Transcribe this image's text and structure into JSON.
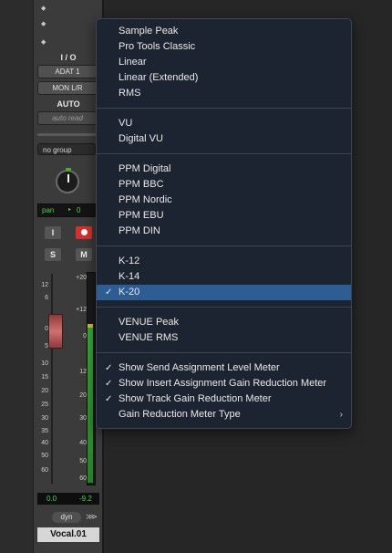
{
  "strip": {
    "io_label": "I / O",
    "input": "ADAT 1",
    "output": "MON L/R",
    "auto_label": "AUTO",
    "auto_mode": "auto read",
    "group": "no group",
    "pan_label": "pan",
    "pan_value": "0",
    "input_button": "I",
    "solo_button": "S",
    "mute_button": "M",
    "fader_scale": [
      "12",
      "6",
      "0",
      "5",
      "10",
      "15",
      "20",
      "25",
      "30",
      "35",
      "40",
      "50",
      "60"
    ],
    "meter_scale": [
      "+20",
      "+12",
      "0",
      "12",
      "20",
      "30",
      "40",
      "50",
      "60"
    ],
    "volume": "0.0",
    "peak": "-9.2",
    "dyn_label": "dyn",
    "track_name": "Vocal.01"
  },
  "menu": {
    "groups": [
      [
        {
          "label": "Sample Peak",
          "checked": false
        },
        {
          "label": "Pro Tools Classic",
          "checked": false
        },
        {
          "label": "Linear",
          "checked": false
        },
        {
          "label": "Linear (Extended)",
          "checked": false
        },
        {
          "label": "RMS",
          "checked": false
        }
      ],
      [
        {
          "label": "VU",
          "checked": false
        },
        {
          "label": "Digital VU",
          "checked": false
        }
      ],
      [
        {
          "label": "PPM Digital",
          "checked": false
        },
        {
          "label": "PPM BBC",
          "checked": false
        },
        {
          "label": "PPM Nordic",
          "checked": false
        },
        {
          "label": "PPM EBU",
          "checked": false
        },
        {
          "label": "PPM DIN",
          "checked": false
        }
      ],
      [
        {
          "label": "K-12",
          "checked": false
        },
        {
          "label": "K-14",
          "checked": false
        },
        {
          "label": "K-20",
          "checked": true,
          "highlighted": true
        }
      ],
      [
        {
          "label": "VENUE Peak",
          "checked": false
        },
        {
          "label": "VENUE RMS",
          "checked": false
        }
      ],
      [
        {
          "label": "Show Send Assignment Level Meter",
          "checked": true
        },
        {
          "label": "Show Insert Assignment Gain Reduction Meter",
          "checked": true
        },
        {
          "label": "Show Track Gain Reduction Meter",
          "checked": true
        },
        {
          "label": "Gain Reduction Meter Type",
          "checked": false,
          "submenu": true
        }
      ]
    ],
    "check_glyph": "✓",
    "submenu_glyph": "›"
  },
  "colors": {
    "menu_bg": "#1d2431",
    "highlight": "#2e5d93",
    "meter_green": "#3fa83f",
    "record_red": "#d03232"
  }
}
